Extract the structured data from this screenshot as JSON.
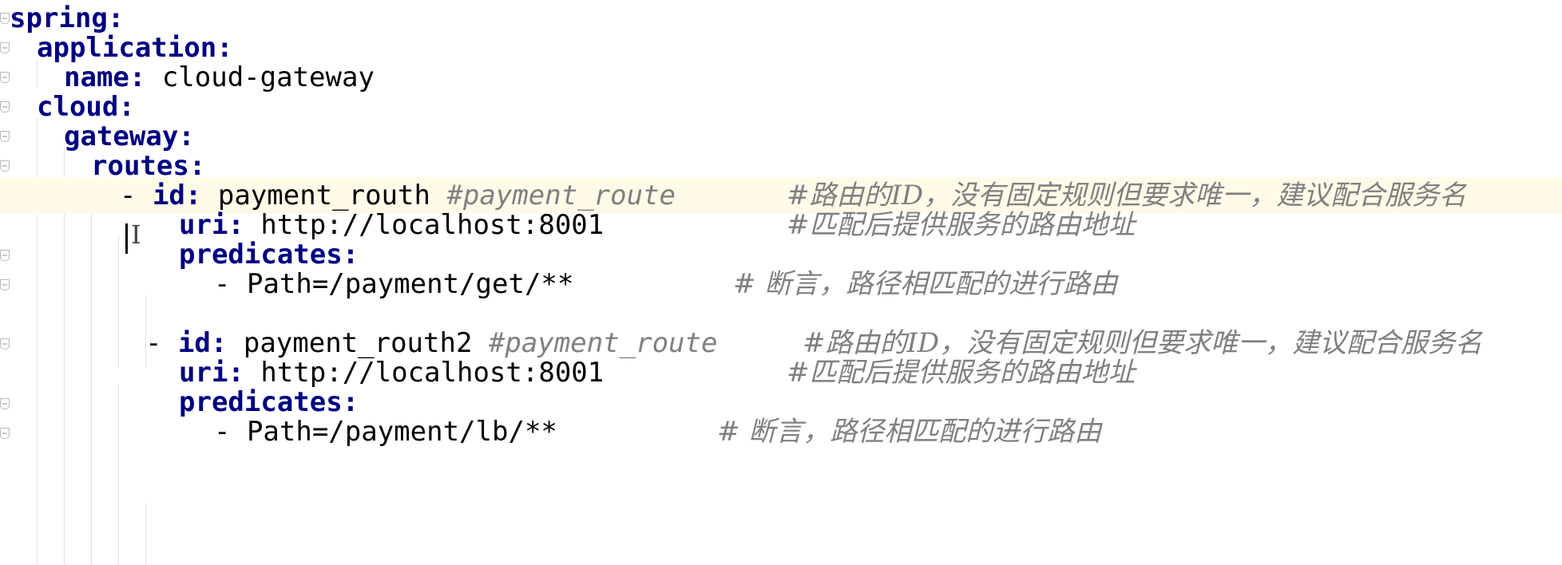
{
  "editor": {
    "language": "yaml",
    "lines": [
      {
        "key": "spring:",
        "value": "",
        "comment": ""
      },
      {
        "key": "application:",
        "value": "",
        "comment": ""
      },
      {
        "key": "name:",
        "value": " cloud-gateway",
        "comment": ""
      },
      {
        "key": "cloud:",
        "value": "",
        "comment": ""
      },
      {
        "key": "gateway:",
        "value": "",
        "comment": ""
      },
      {
        "key": "routes:",
        "value": "",
        "comment": ""
      },
      {
        "dash": "- ",
        "key": "id:",
        "value": " payment_routh ",
        "comment1": "#payment_route",
        "comment": "#路由的ID，没有固定规则但要求唯一，建议配合服务名"
      },
      {
        "key": "uri:",
        "value": " http://localhost:8001",
        "comment": "#匹配后提供服务的路由地址"
      },
      {
        "key": "predicates:",
        "value": "",
        "comment": ""
      },
      {
        "dash": "- ",
        "value": "Path=/payment/get/**",
        "comment": "# 断言，路径相匹配的进行路由"
      },
      {
        "dash": "- ",
        "key": "id:",
        "value": " payment_routh2 ",
        "comment1": "#payment_route",
        "comment": "#路由的ID，没有固定规则但要求唯一，建议配合服务名"
      },
      {
        "key": "uri:",
        "value": " http://localhost:8001",
        "comment": "#匹配后提供服务的路由地址"
      },
      {
        "key": "predicates:",
        "value": "",
        "comment": ""
      },
      {
        "dash": "- ",
        "value": "Path=/payment/lb/**",
        "comment": "# 断言，路径相匹配的进行路由"
      }
    ]
  }
}
